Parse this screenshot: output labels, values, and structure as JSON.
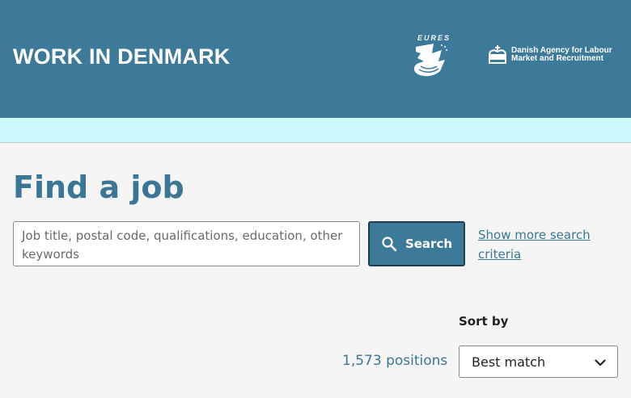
{
  "header": {
    "brand": "WORK IN DENMARK",
    "eures_label": "EURES",
    "agency_line1": "Danish Agency for Labour",
    "agency_line2": "Market and Recruitment",
    "color": "#3d7a99"
  },
  "band": {
    "color": "#cdf8fb"
  },
  "main": {
    "title": "Find a job",
    "search_placeholder": "Job title, postal code, qualifications, education, other keywords",
    "search_button": "Search",
    "more_link": "Show more search criteria",
    "sort_label": "Sort by",
    "count": "1,573 positions",
    "sort_selected": "Best match"
  },
  "icons": {
    "search": "magnifier-icon",
    "dropdown": "chevron-down-icon",
    "crown": "crown-icon",
    "eures_logo": "eures-swan-icon"
  }
}
